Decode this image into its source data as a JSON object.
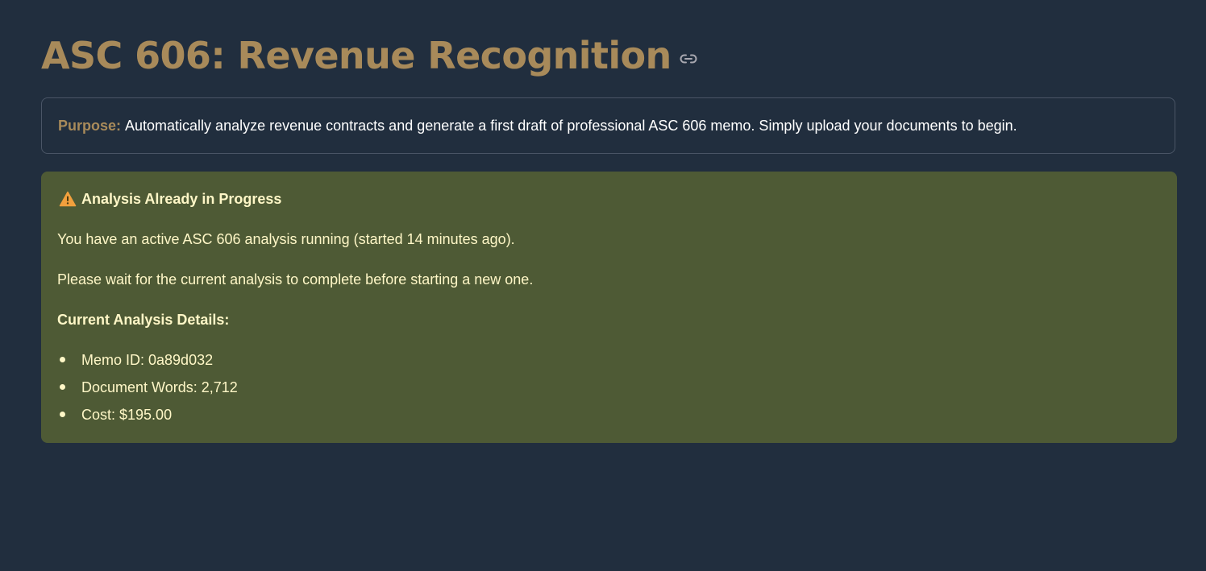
{
  "header": {
    "title": "ASC 606: Revenue Recognition",
    "link_icon": "link-icon"
  },
  "purpose": {
    "label": "Purpose:",
    "text": "Automatically analyze revenue contracts and generate a first draft of professional ASC 606 memo. Simply upload your documents to begin."
  },
  "alert": {
    "icon": "warning-icon",
    "heading": "Analysis Already in Progress",
    "line1": "You have an active ASC 606 analysis running (started 14 minutes ago).",
    "line2": "Please wait for the current analysis to complete before starting a new one.",
    "details_heading": "Current Analysis Details:",
    "details": [
      "Memo ID: 0a89d032",
      "Document Words: 2,712",
      "Cost: $195.00"
    ]
  },
  "colors": {
    "background": "#212e3e",
    "accent": "#a88a5a",
    "alert_background": "#4e5a35",
    "alert_text": "#fff7c7",
    "warning_icon": "#f2a03d"
  }
}
